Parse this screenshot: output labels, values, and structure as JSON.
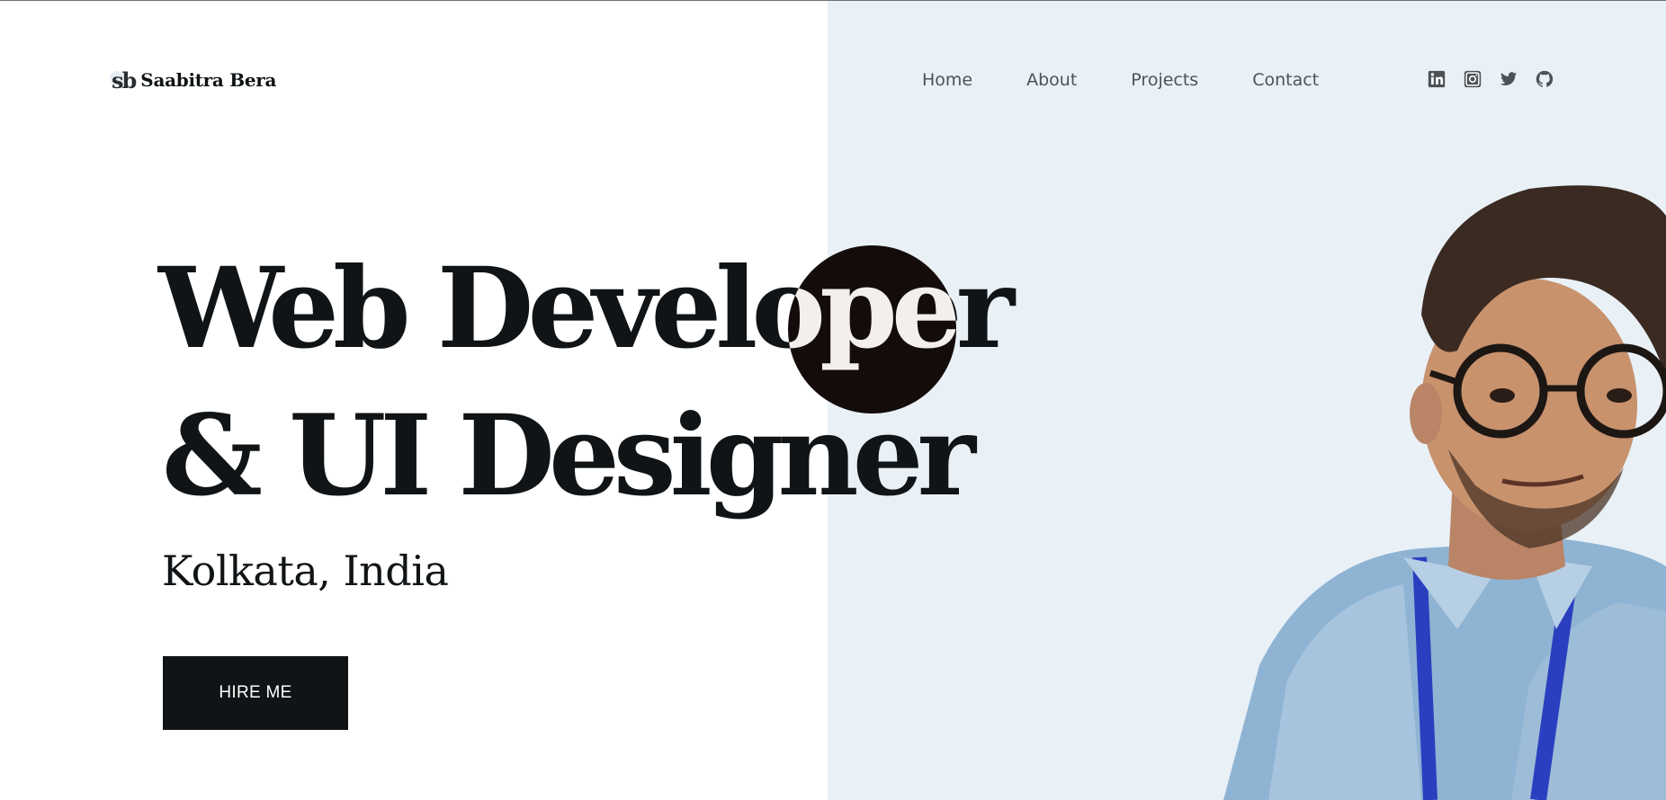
{
  "header": {
    "logo_mark": "sb",
    "logo_name": "Saabitra Bera",
    "nav": [
      {
        "label": "Home"
      },
      {
        "label": "About"
      },
      {
        "label": "Projects"
      },
      {
        "label": "Contact"
      }
    ],
    "socials": [
      "linkedin-icon",
      "instagram-icon",
      "twitter-icon",
      "github-icon"
    ]
  },
  "hero": {
    "line1_prefix": "Web Develo",
    "line1_full": "Web Developer",
    "line2": "& UI Designer",
    "location": "Kolkata, India",
    "cta_label": "HIRE ME"
  },
  "colors": {
    "text": "#101416",
    "accent_panel": "#e9f1f7",
    "circle": "#130c0a",
    "nav_text": "#4d5257"
  }
}
